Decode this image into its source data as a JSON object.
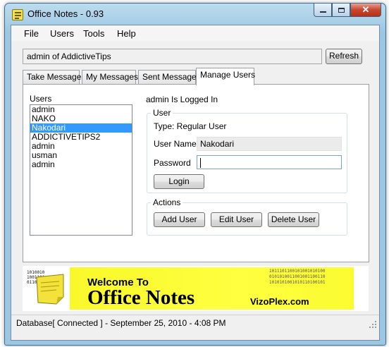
{
  "window": {
    "title": "Office Notes - 0.93"
  },
  "menu": [
    "File",
    "Users",
    "Tools",
    "Help"
  ],
  "status_field": "admin of AddictiveTips",
  "refresh_label": "Refresh",
  "tabs": [
    "Take Message",
    "My Messages",
    "Sent Messages",
    "Manage Users"
  ],
  "active_tab": "Manage Users",
  "users": {
    "label": "Users",
    "items": [
      "admin",
      "NAKO",
      "Nakodari",
      "ADDICTIVETIPS2",
      "admin",
      "usman",
      "admin"
    ],
    "selected_index": 2
  },
  "logged_in_text": "admin Is Logged In",
  "user_group": {
    "title": "User",
    "type_text": "Type: Regular User",
    "username_label": "User Name",
    "username_value": "Nakodari",
    "password_label": "Password",
    "password_value": "",
    "login_label": "Login"
  },
  "actions_group": {
    "title": "Actions",
    "add_label": "Add User",
    "edit_label": "Edit User",
    "delete_label": "Delete User"
  },
  "banner": {
    "welcome": "Welcome To",
    "brand": "Office Notes",
    "website": "VizoPlex.com",
    "binary_left": [
      "1010010",
      "1001101",
      "0110100"
    ],
    "binary_right": [
      "1011101100101001010100",
      "0101010011001001100110",
      "1010101001010110100101"
    ]
  },
  "statusbar": "Database[ Connected ] - September 25, 2010 - 4:08 PM",
  "colors": {
    "selection": "#3399ff",
    "banner_yellow": "#ffff40",
    "title_bar": "#a6cde6",
    "close_button": "#c8462f"
  },
  "icons": [
    "app-notes-icon",
    "minimize-icon",
    "maximize-icon",
    "close-icon",
    "sticky-note-icon",
    "resize-grip-icon"
  ]
}
